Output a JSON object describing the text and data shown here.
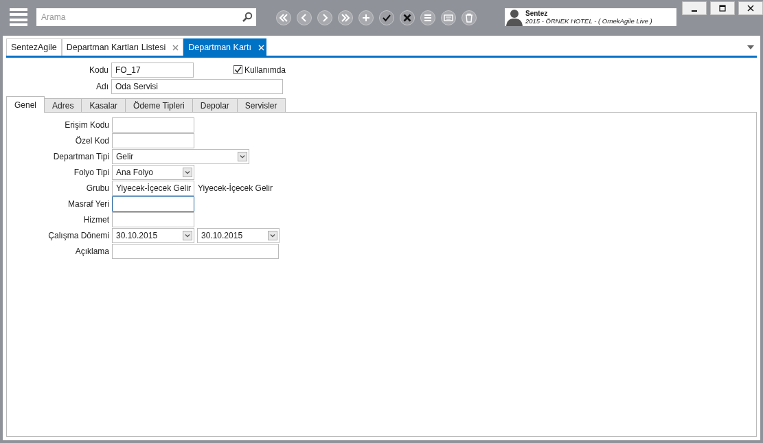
{
  "search": {
    "placeholder": "Arama"
  },
  "toolbar": [
    {
      "kind": "first"
    },
    {
      "kind": "prev"
    },
    {
      "kind": "next"
    },
    {
      "kind": "last"
    },
    {
      "kind": "add"
    },
    {
      "kind": "save"
    },
    {
      "kind": "cancel"
    },
    {
      "kind": "list"
    },
    {
      "kind": "keyboard"
    },
    {
      "kind": "delete"
    }
  ],
  "user": {
    "name": "Sentez",
    "detail": "2015 - ÖRNEK HOTEL - ( OrnekAgile  Live )"
  },
  "doc_tabs": [
    {
      "label": "SentezAgile",
      "closable": false,
      "selected": false
    },
    {
      "label": "Departman Kartları Listesi",
      "closable": true,
      "selected": false
    },
    {
      "label": "Departman Kartı",
      "closable": true,
      "selected": true
    }
  ],
  "header": {
    "code_label": "Kodu",
    "code": "FO_17",
    "in_use_label": "Kullanımda",
    "in_use": true,
    "name_label": "Adı",
    "name": "Oda Servisi"
  },
  "tabs": [
    {
      "label": "Genel",
      "selected": true
    },
    {
      "label": "Adres",
      "selected": false
    },
    {
      "label": "Kasalar",
      "selected": false
    },
    {
      "label": "Ödeme Tipleri",
      "selected": false
    },
    {
      "label": "Depolar",
      "selected": false
    },
    {
      "label": "Servisler",
      "selected": false
    }
  ],
  "fields": [
    {
      "kind": "text",
      "label": "Erişim Kodu",
      "focused": false
    },
    {
      "kind": "text",
      "label": "Özel Kod",
      "focused": false
    },
    {
      "kind": "long-select",
      "label": "Departman Tipi",
      "value": "Gelir",
      "focused": false
    },
    {
      "kind": "select",
      "label": "Folyo Tipi",
      "value": "Ana Folyo",
      "focused": false
    },
    {
      "kind": "lookup",
      "label": "Grubu",
      "value": "Yiyecek-İçecek Gelir",
      "note": "Yiyecek-İçecek Gelir",
      "focused": false
    },
    {
      "kind": "text",
      "label": "Masraf Yeri",
      "focused": true
    },
    {
      "kind": "text",
      "label": "Hizmet",
      "focused": false
    },
    {
      "kind": "date-range",
      "label": "Çalışma Dönemi",
      "value": "30.10.2015",
      "value_to": "30.10.2015",
      "focused": false
    },
    {
      "kind": "long-text",
      "label": "Açıklama",
      "focused": false
    }
  ]
}
